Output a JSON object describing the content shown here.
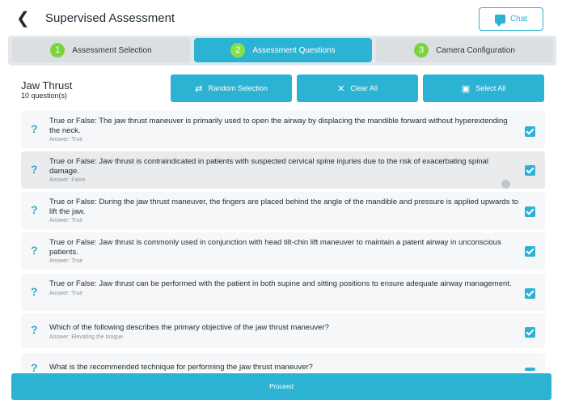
{
  "header": {
    "back_icon": "chevron-left-icon",
    "title": "Supervised Assessment",
    "chat_label": "Chat",
    "chat_icon": "chat-bubble-icon"
  },
  "steps": [
    {
      "number": "1",
      "label": "Assessment Selection",
      "active": false
    },
    {
      "number": "2",
      "label": "Assessment Questions",
      "active": true
    },
    {
      "number": "3",
      "label": "Camera Configuration",
      "active": false
    }
  ],
  "section": {
    "title": "Jaw Thrust",
    "subtitle": "10 question(s)"
  },
  "actions": {
    "random_label": "Random Selection",
    "random_icon": "shuffle-icon",
    "clear_label": "Clear All",
    "clear_icon": "close-icon",
    "select_label": "Select All",
    "select_icon": "select-all-icon"
  },
  "questions": [
    {
      "text": "True or False: The jaw thrust maneuver is primarily used to open the airway by displacing the mandible forward without hyperextending the neck.",
      "answer": "Answer: True",
      "checked": true
    },
    {
      "text": "True or False: Jaw thrust is contraindicated in patients with suspected cervical spine injuries due to the risk of exacerbating spinal damage.",
      "answer": "Answer: False",
      "checked": true
    },
    {
      "text": "True or False: During the jaw thrust maneuver, the fingers are placed behind the angle of the mandible and pressure is applied upwards to lift the jaw.",
      "answer": "Answer: True",
      "checked": true
    },
    {
      "text": "True or False: Jaw thrust is commonly used in conjunction with head tilt-chin lift maneuver to maintain a patent airway in unconscious patients.",
      "answer": "Answer: True",
      "checked": true
    },
    {
      "text": "True or False: Jaw thrust can be performed with the patient in both supine and sitting positions to ensure adequate airway management.",
      "answer": "Answer: True",
      "checked": true
    },
    {
      "text": "Which of the following describes the primary objective of the jaw thrust maneuver?",
      "answer": "Answer: Elevating the tongue",
      "checked": true
    },
    {
      "text": "What is the recommended technique for performing the jaw thrust maneuver?",
      "answer": "",
      "checked": true
    }
  ],
  "question_mark": "?",
  "proceed_label": "Proceed",
  "colors": {
    "accent": "#2cb3d4",
    "step_number": "#7bd33f",
    "row_bg": "#f6f7f8"
  }
}
